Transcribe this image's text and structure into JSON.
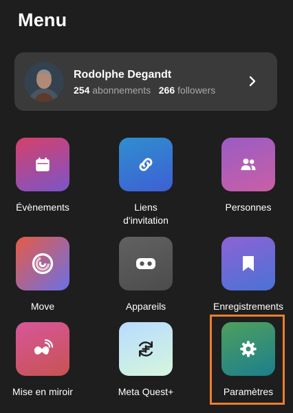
{
  "header": {
    "title": "Menu"
  },
  "profile": {
    "name": "Rodolphe Degandt",
    "following_count": "254",
    "following_label": "abonnements",
    "followers_count": "266",
    "followers_label": "followers"
  },
  "tiles": [
    {
      "label": "Évènements",
      "icon": "calendar-icon",
      "gradient": [
        "#d6406a",
        "#7b55c9"
      ]
    },
    {
      "label": "Liens d'invitation",
      "icon": "link-icon",
      "gradient": [
        "#2f8fcf",
        "#3e5fd4"
      ]
    },
    {
      "label": "Personnes",
      "icon": "people-icon",
      "gradient": [
        "#9a5cc4",
        "#c95fa6"
      ]
    },
    {
      "label": "Move",
      "icon": "move-ring-icon",
      "gradient": [
        "#e55b45",
        "#6b70e6"
      ]
    },
    {
      "label": "Appareils",
      "icon": "vr-headset-icon",
      "gradient": [
        "#616161",
        "#4c4c4c"
      ]
    },
    {
      "label": "Enregistrements",
      "icon": "bookmark-icon",
      "gradient": [
        "#8d63d3",
        "#4a72d6"
      ]
    },
    {
      "label": "Mise en miroir",
      "icon": "cast-icon",
      "gradient": [
        "#d8569a",
        "#c65353"
      ]
    },
    {
      "label": "Meta Quest+",
      "icon": "quest-plus-icon",
      "gradient": [
        "#b7dcff",
        "#d6f6dd"
      ]
    },
    {
      "label": "Paramètres",
      "icon": "gear-icon",
      "gradient": [
        "#4f9f5d",
        "#1c7f8d"
      ]
    }
  ],
  "colors": {
    "highlight": "#ef7e2e",
    "card_bg": "#3a3a3a",
    "page_bg": "#1e1e1e"
  }
}
